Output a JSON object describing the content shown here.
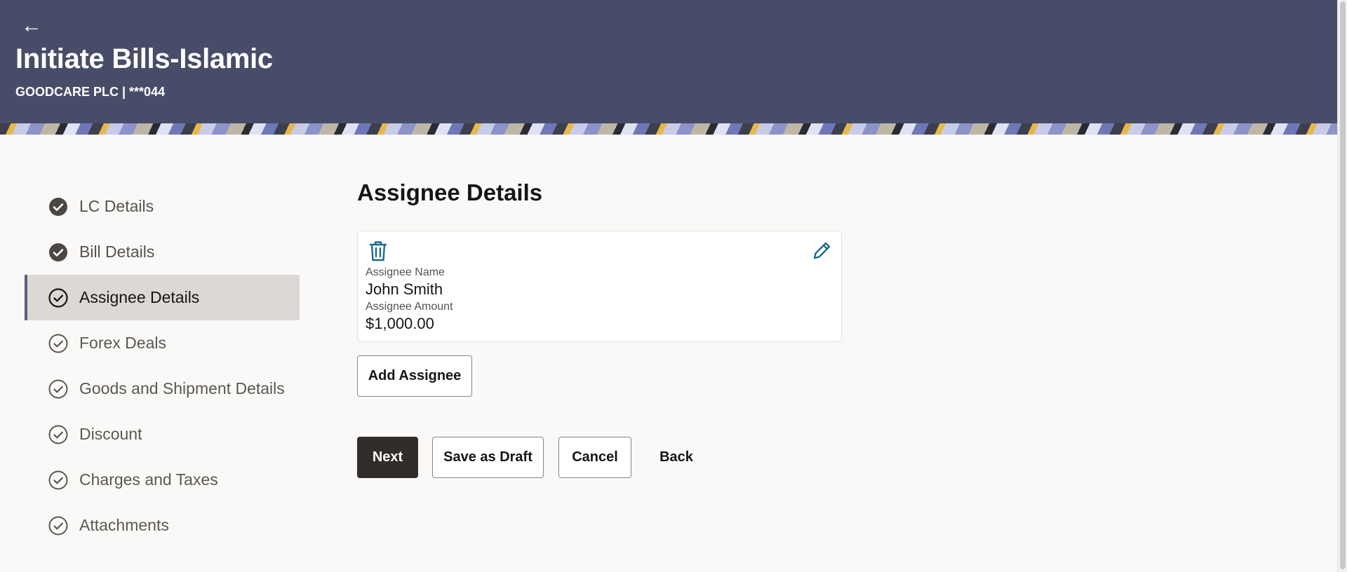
{
  "header": {
    "back_icon": "arrow-left-icon",
    "title": "Initiate Bills-Islamic",
    "subtitle": "GOODCARE PLC | ***044"
  },
  "steps": [
    {
      "label": "LC Details",
      "state": "completed"
    },
    {
      "label": "Bill Details",
      "state": "completed"
    },
    {
      "label": "Assignee Details",
      "state": "active"
    },
    {
      "label": "Forex Deals",
      "state": "pending"
    },
    {
      "label": "Goods and Shipment Details",
      "state": "pending"
    },
    {
      "label": "Discount",
      "state": "pending"
    },
    {
      "label": "Charges and Taxes",
      "state": "pending"
    },
    {
      "label": "Attachments",
      "state": "pending"
    }
  ],
  "main": {
    "section_title": "Assignee Details",
    "card": {
      "delete_icon": "trash-icon",
      "edit_icon": "pencil-icon",
      "name_label": "Assignee Name",
      "name_value": "John Smith",
      "amount_label": "Assignee Amount",
      "amount_value": "$1,000.00"
    },
    "add_assignee_label": "Add Assignee"
  },
  "actions": {
    "next_label": "Next",
    "save_draft_label": "Save as Draft",
    "cancel_label": "Cancel",
    "back_label": "Back"
  },
  "colors": {
    "header_bg": "#474c69",
    "page_bg": "#faf9f8",
    "primary_button": "#312d2a",
    "active_step_bg": "#dcd8d5",
    "icon_accent": "#1b6a8e"
  }
}
